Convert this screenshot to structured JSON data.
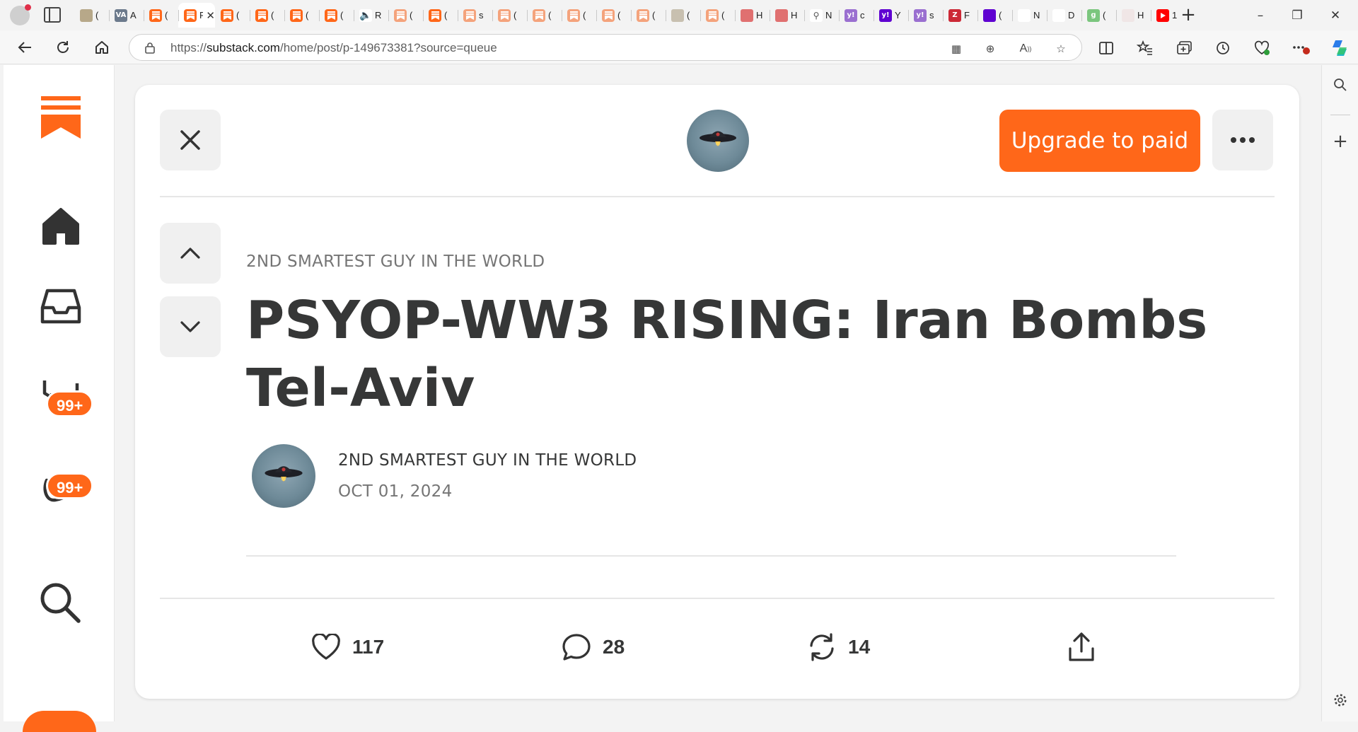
{
  "browser": {
    "tabs": [
      {
        "fav": "image-icon",
        "color": "#b7a889",
        "text": "("
      },
      {
        "fav": "va-icon",
        "color": "#6c7a8c",
        "glyph": "VA",
        "text": "A"
      },
      {
        "fav": "substack-icon",
        "color": "#ff6719",
        "text": "("
      },
      {
        "fav": "substack-icon",
        "color": "#ff6719",
        "text": "F",
        "active": true
      },
      {
        "fav": "substack-icon",
        "color": "#ff6719",
        "text": "("
      },
      {
        "fav": "substack-icon",
        "color": "#ff6719",
        "text": "("
      },
      {
        "fav": "substack-icon",
        "color": "#ff6719",
        "text": "("
      },
      {
        "fav": "substack-icon",
        "color": "#ff6719",
        "text": "("
      },
      {
        "fav": "speaker-icon",
        "color": "#ffffff",
        "text": "R"
      },
      {
        "fav": "substack-icon",
        "color": "#f4a37c",
        "text": "("
      },
      {
        "fav": "substack-icon",
        "color": "#ff6719",
        "text": "("
      },
      {
        "fav": "substack-icon",
        "color": "#f4a37c",
        "text": "s"
      },
      {
        "fav": "substack-icon",
        "color": "#f4a37c",
        "text": "("
      },
      {
        "fav": "substack-icon",
        "color": "#f4a37c",
        "text": "("
      },
      {
        "fav": "substack-icon",
        "color": "#f4a37c",
        "text": "("
      },
      {
        "fav": "substack-icon",
        "color": "#f4a37c",
        "text": "("
      },
      {
        "fav": "substack-icon",
        "color": "#f4a37c",
        "text": "("
      },
      {
        "fav": "image-icon",
        "color": "#c8c0b0",
        "text": "("
      },
      {
        "fav": "substack-icon",
        "color": "#f4a37c",
        "text": "("
      },
      {
        "fav": "mic-icon",
        "color": "#e07070",
        "text": "H"
      },
      {
        "fav": "mic-icon",
        "color": "#e07070",
        "text": "H"
      },
      {
        "fav": "search-icon",
        "color": "#ffffff",
        "text": "N"
      },
      {
        "fav": "yahoo-icon",
        "color": "#9a6fd0",
        "glyph": "y!",
        "text": "c"
      },
      {
        "fav": "yahoo-icon",
        "color": "#5f01d1",
        "glyph": "y!",
        "text": "Y"
      },
      {
        "fav": "yahoo-icon",
        "color": "#9a6fd0",
        "glyph": "y!",
        "text": "s"
      },
      {
        "fav": "zotero-icon",
        "color": "#cc2936",
        "glyph": "Z",
        "text": "F"
      },
      {
        "fav": "mail-icon",
        "color": "#5f01d1",
        "text": "("
      },
      {
        "fav": "health-icon",
        "color": "#ffffff",
        "text": "N"
      },
      {
        "fav": "stripes-icon",
        "color": "#ffffff",
        "text": "D"
      },
      {
        "fav": "g-icon",
        "color": "#7bc67e",
        "glyph": "g",
        "text": "("
      },
      {
        "fav": "feather-icon",
        "color": "#f0e6e6",
        "text": "H"
      },
      {
        "fav": "youtube-icon",
        "color": "#ff0000",
        "text": "1"
      }
    ],
    "url_prefix": "https://",
    "url_host": "substack.com",
    "url_path": "/home/post/p-149673381?source=queue"
  },
  "app": {
    "brand": "Substack",
    "chat_badge": "99+",
    "activity_badge": "99+"
  },
  "post": {
    "upgrade_label": "Upgrade to paid",
    "publication": "2ND SMARTEST GUY IN THE WORLD",
    "title": "PSYOP-WW3 RISING: Iran Bombs Tel-Aviv",
    "author": "2ND SMARTEST GUY IN THE WORLD",
    "date": "OCT 01, 2024",
    "likes": "117",
    "comments": "28",
    "restacks": "14"
  },
  "colors": {
    "accent": "#ff6719",
    "text": "#363737",
    "muted": "#757575"
  }
}
